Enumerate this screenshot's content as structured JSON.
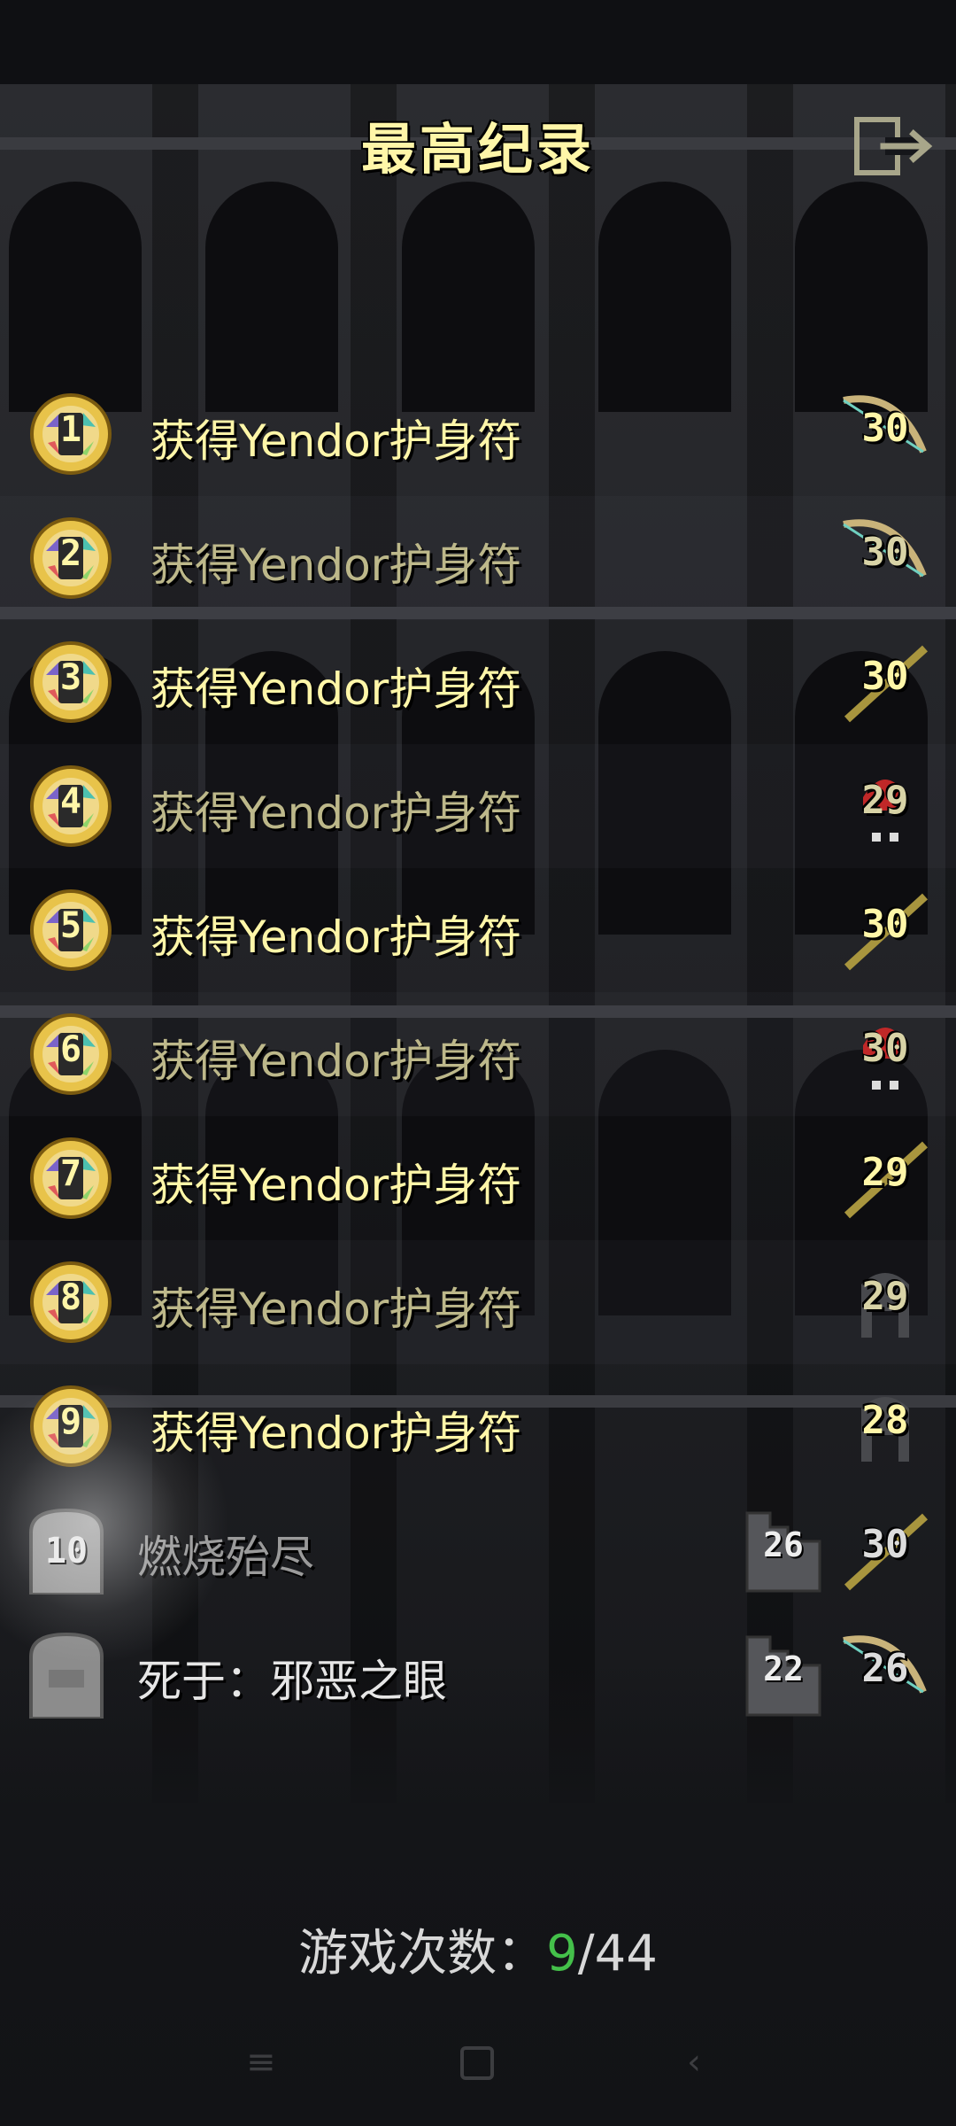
{
  "header": {
    "title": "最高纪录",
    "exit_icon": "exit-icon"
  },
  "records": [
    {
      "rank": "1",
      "text": "获得Yendor护身符",
      "level": "30",
      "class_icon": "bow-icon"
    },
    {
      "rank": "2",
      "text": "获得Yendor护身符",
      "level": "30",
      "class_icon": "bow-icon"
    },
    {
      "rank": "3",
      "text": "获得Yendor护身符",
      "level": "30",
      "class_icon": "staff-icon"
    },
    {
      "rank": "4",
      "text": "获得Yendor护身符",
      "level": "29",
      "class_icon": "red-hood-icon"
    },
    {
      "rank": "5",
      "text": "获得Yendor护身符",
      "level": "30",
      "class_icon": "staff-icon"
    },
    {
      "rank": "6",
      "text": "获得Yendor护身符",
      "level": "30",
      "class_icon": "red-hood-icon"
    },
    {
      "rank": "7",
      "text": "获得Yendor护身符",
      "level": "29",
      "class_icon": "staff-icon"
    },
    {
      "rank": "8",
      "text": "获得Yendor护身符",
      "level": "29",
      "class_icon": "helmet-icon"
    },
    {
      "rank": "9",
      "text": "获得Yendor护身符",
      "level": "28",
      "class_icon": "helmet-icon"
    },
    {
      "rank": "10",
      "text": "燃烧殆尽",
      "depth": "26",
      "level": "30",
      "class_icon": "staff-icon"
    },
    {
      "rank": "",
      "text": "死于：邪恶之眼",
      "depth": "22",
      "level": "26",
      "class_icon": "bow-icon"
    }
  ],
  "footer": {
    "label": "游戏次数：",
    "current": "9",
    "separator": "/",
    "total": "44"
  },
  "colors": {
    "title": "#fff6a8",
    "highlight": "#44c04a"
  }
}
